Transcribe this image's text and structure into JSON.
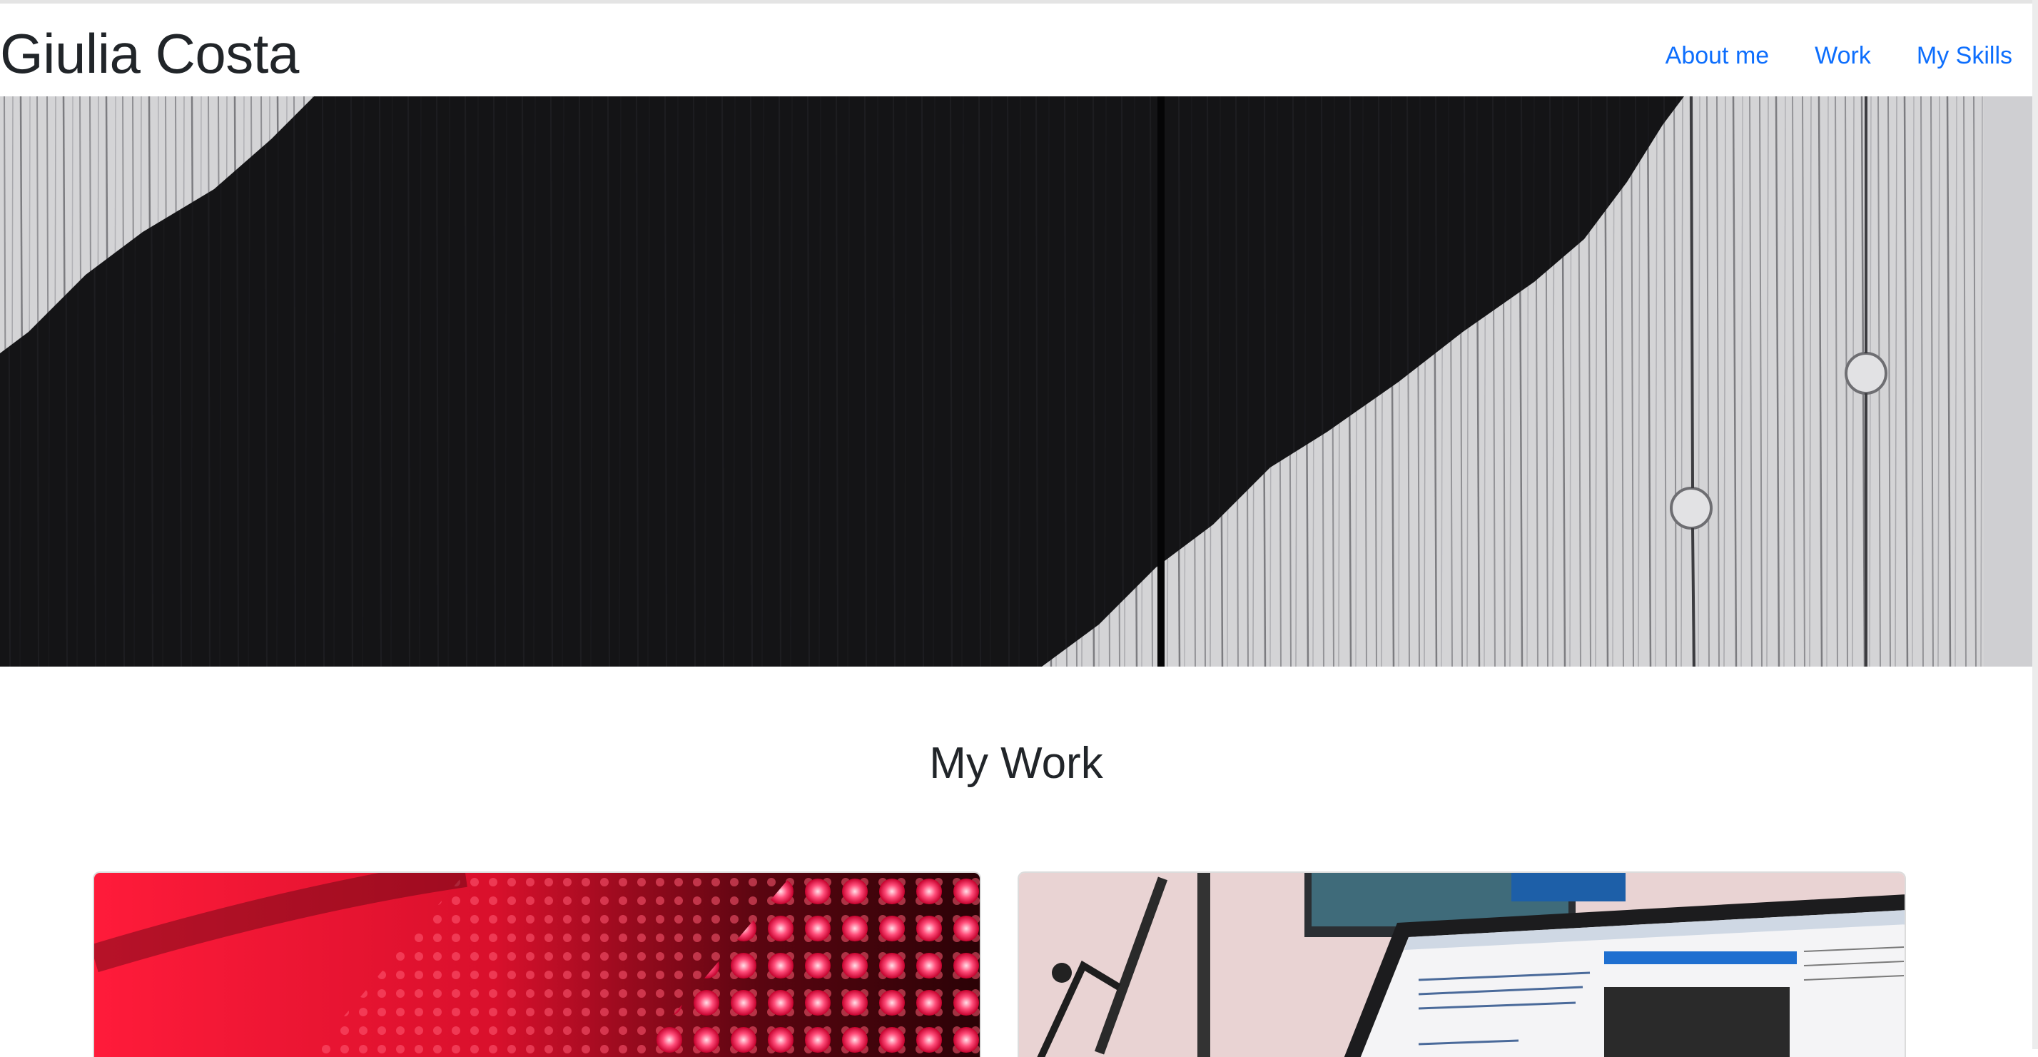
{
  "header": {
    "brand": "Giulia Costa",
    "nav": [
      {
        "label": "About me"
      },
      {
        "label": "Work"
      },
      {
        "label": "My Skills"
      }
    ]
  },
  "hero": {
    "image": "black-and-white-painted-wood-photo"
  },
  "work": {
    "title": "My Work",
    "cards": [
      {
        "image": "red-led-dot-panel-photo"
      },
      {
        "image": "laptop-code-editor-photo"
      }
    ]
  },
  "colors": {
    "link": "#0d6efd",
    "text": "#212529",
    "background": "#ffffff"
  }
}
